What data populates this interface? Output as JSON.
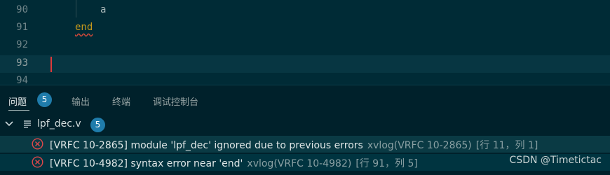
{
  "editor": {
    "lines": [
      {
        "num": "90",
        "text": "a"
      },
      {
        "num": "91",
        "text": "end"
      },
      {
        "num": "92",
        "text": ""
      },
      {
        "num": "93",
        "text": ""
      },
      {
        "num": "94",
        "text": ""
      }
    ]
  },
  "panel": {
    "tabs": [
      {
        "label": "问题",
        "badge": "5"
      },
      {
        "label": "输出"
      },
      {
        "label": "终端"
      },
      {
        "label": "调试控制台"
      }
    ],
    "file": {
      "name": "lpf_dec.v",
      "count": "5"
    },
    "problems": [
      {
        "message": "[VRFC 10-2865] module 'lpf_dec' ignored due to previous errors",
        "source": "xvlog(VRFC 10-2865)",
        "location": "[行 11，列 1]"
      },
      {
        "message": "[VRFC 10-4982] syntax error near 'end'",
        "source": "xvlog(VRFC 10-4982)",
        "location": "[行 91，列 5]"
      }
    ]
  },
  "watermark": "CSDN @Timetictac",
  "colors": {
    "editor_bg": "#002b36",
    "panel_bg": "#00212b",
    "keyword": "#c49a1c",
    "error": "#e0484a",
    "badge": "#1f7cab"
  }
}
